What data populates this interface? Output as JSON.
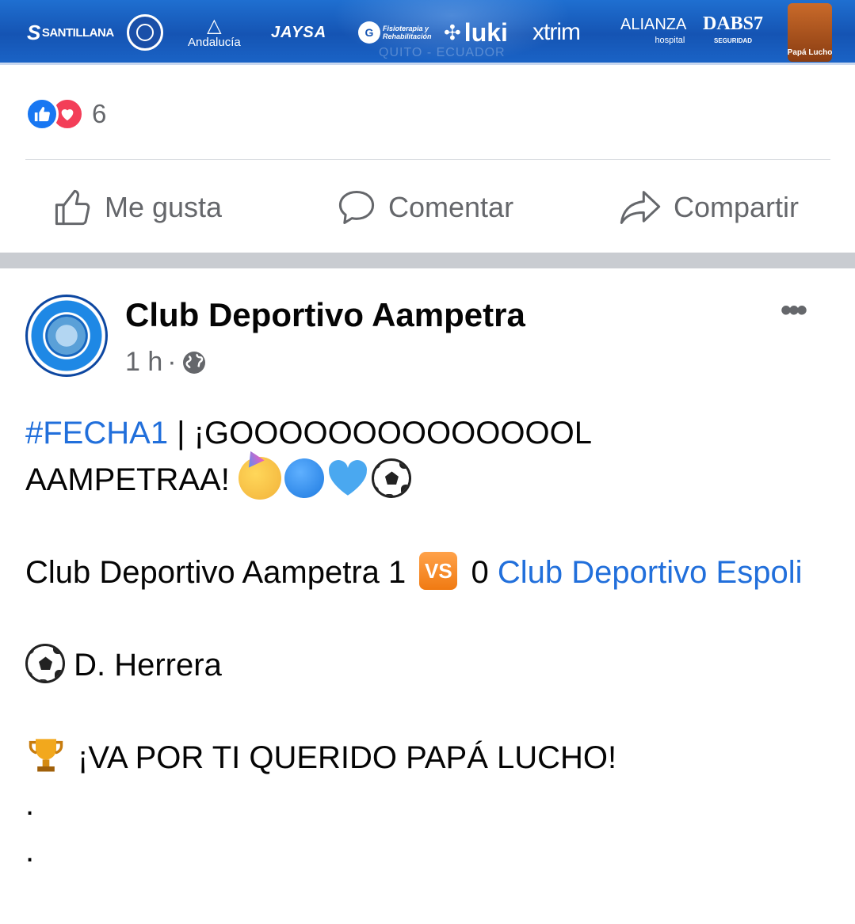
{
  "banner": {
    "sponsors": [
      "SANTILLANA",
      "Andalucía",
      "JAYSA",
      "Fisioterapia y Rehabilitación",
      "luki",
      "xtrim",
      "ALIANZA",
      "hospital",
      "DABS7",
      "SEGURIDAD",
      "Papá Lucho"
    ],
    "watermark": "QUITO - ECUADOR"
  },
  "reactions": {
    "count": "6",
    "icons": [
      "like-icon",
      "love-icon"
    ]
  },
  "actions": {
    "like_label": "Me gusta",
    "comment_label": "Comentar",
    "share_label": "Compartir"
  },
  "post": {
    "author": "Club Deportivo Aampetra",
    "time": "1 h",
    "meta_sep": "·",
    "audience_icon": "globe-icon",
    "hashtag": "#FECHA1",
    "headline_rest": " | ¡GOOOOOOOOOOOOOOL",
    "headline_line2": "AAMPETRAA! ",
    "score_home": "Club Deportivo Aampetra 1 ",
    "vs_label": "VS",
    "score_away_num": " 0 ",
    "away_team": "Club Deportivo Espoli",
    "scorer": " D. Herrera",
    "dedication": "¡VA POR TI QUERIDO PAPÁ LUCHO!",
    "dot1": ".",
    "dot2": "."
  },
  "colors": {
    "link": "#216fdb",
    "muted": "#65676b",
    "like_blue": "#1877f2",
    "love_red": "#f33e58"
  }
}
